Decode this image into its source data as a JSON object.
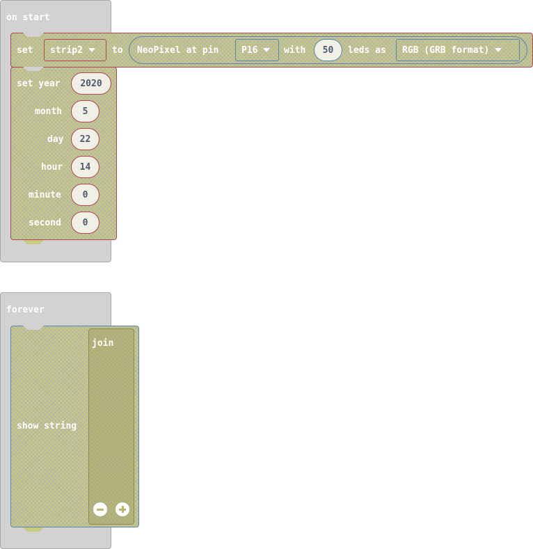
{
  "on_start": {
    "label": "on start",
    "set_block": {
      "set_label": "set",
      "variable": "strip2",
      "to_label": "to",
      "neopixel_label": "NeoPixel at pin",
      "pin": "P16",
      "with_label": "with",
      "leds_count": "50",
      "leds_as_label": "leds as",
      "format": "RGB (GRB format)"
    },
    "set_time_block": {
      "rows": [
        {
          "label": "set year",
          "value": "2020"
        },
        {
          "label": "month",
          "value": "5"
        },
        {
          "label": "day",
          "value": "22"
        },
        {
          "label": "hour",
          "value": "14"
        },
        {
          "label": "minute",
          "value": "0"
        },
        {
          "label": "second",
          "value": "0"
        }
      ]
    }
  },
  "forever": {
    "label": "forever",
    "show_string_label": "show string",
    "join_label": "join"
  }
}
